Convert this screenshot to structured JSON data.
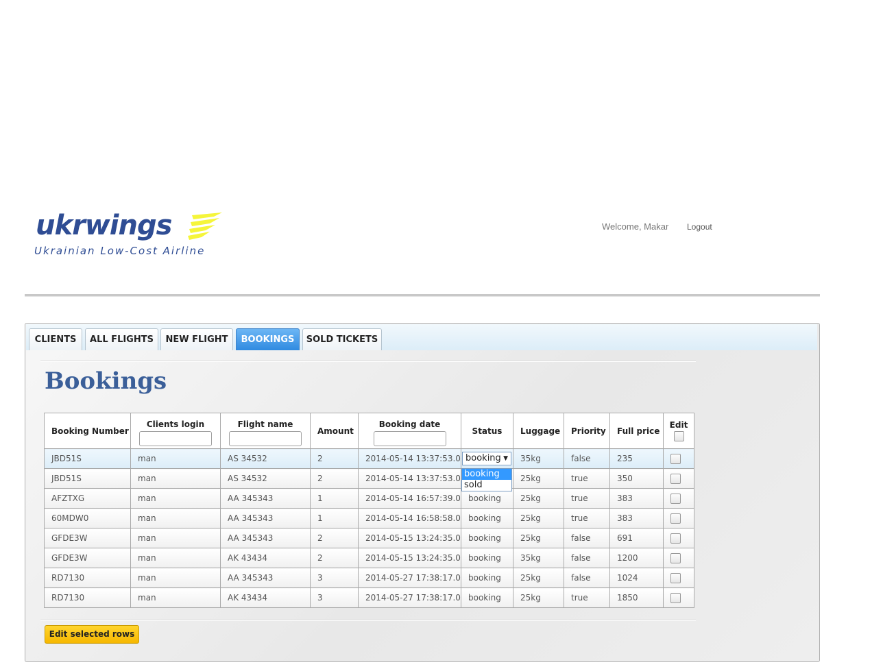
{
  "header": {
    "brand": "ukrwings",
    "tagline": "Ukrainian Low-Cost Airline",
    "welcome": "Welcome, Makar",
    "logout": "Logout",
    "brand_color": "#2f4d94",
    "logo_accent_color": "#f5f53a"
  },
  "tabs": [
    {
      "label": "CLIENTS",
      "active": false
    },
    {
      "label": "ALL FLIGHTS",
      "active": false
    },
    {
      "label": "NEW FLIGHT",
      "active": false
    },
    {
      "label": "BOOKINGS",
      "active": true
    },
    {
      "label": "SOLD TICKETS",
      "active": false
    }
  ],
  "page": {
    "title": "Bookings",
    "edit_button": "Edit selected rows"
  },
  "table": {
    "columns": [
      "Booking Number",
      "Clients login",
      "Flight name",
      "Amount",
      "Booking date",
      "Status",
      "Luggage",
      "Priority",
      "Full price",
      "Edit"
    ],
    "rows": [
      [
        "JBD51S",
        "man",
        "AS 34532",
        "2",
        "2014-05-14 13:37:53.0",
        "booking",
        "35kg",
        "false",
        "235"
      ],
      [
        "JBD51S",
        "man",
        "AS 34532",
        "2",
        "2014-05-14 13:37:53.0",
        "booking",
        "25kg",
        "true",
        "350"
      ],
      [
        "AFZTXG",
        "man",
        "AA 345343",
        "1",
        "2014-05-14 16:57:39.0",
        "booking",
        "25kg",
        "true",
        "383"
      ],
      [
        "60MDW0",
        "man",
        "AA 345343",
        "1",
        "2014-05-14 16:58:58.0",
        "booking",
        "25kg",
        "true",
        "383"
      ],
      [
        "GFDE3W",
        "man",
        "AA 345343",
        "2",
        "2014-05-15 13:24:35.0",
        "booking",
        "25kg",
        "false",
        "691"
      ],
      [
        "GFDE3W",
        "man",
        "AK 43434",
        "2",
        "2014-05-15 13:24:35.0",
        "booking",
        "35kg",
        "false",
        "1200"
      ],
      [
        "RD7130",
        "man",
        "AA 345343",
        "3",
        "2014-05-27 17:38:17.0",
        "booking",
        "25kg",
        "false",
        "1024"
      ],
      [
        "RD7130",
        "man",
        "AK 43434",
        "3",
        "2014-05-27 17:38:17.0",
        "booking",
        "25kg",
        "true",
        "1850"
      ]
    ]
  },
  "status_dropdown": {
    "selected": "booking",
    "options": [
      "booking",
      "sold"
    ]
  }
}
